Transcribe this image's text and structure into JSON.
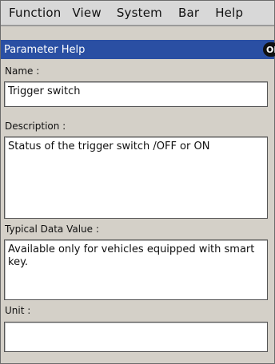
{
  "menu": {
    "items": [
      "Function",
      "View",
      "System",
      "Bar",
      "Help"
    ]
  },
  "dialog": {
    "title": "Parameter Help",
    "ok_label": "OK"
  },
  "fields": {
    "name": {
      "label": "Name :",
      "value": "Trigger switch"
    },
    "description": {
      "label": "Description :",
      "value": "Status of the trigger switch /OFF or ON"
    },
    "typical": {
      "label": "Typical Data Value :",
      "value": "Available only for vehicles equipped with smart key."
    },
    "unit": {
      "label": "Unit :",
      "value": ""
    }
  }
}
